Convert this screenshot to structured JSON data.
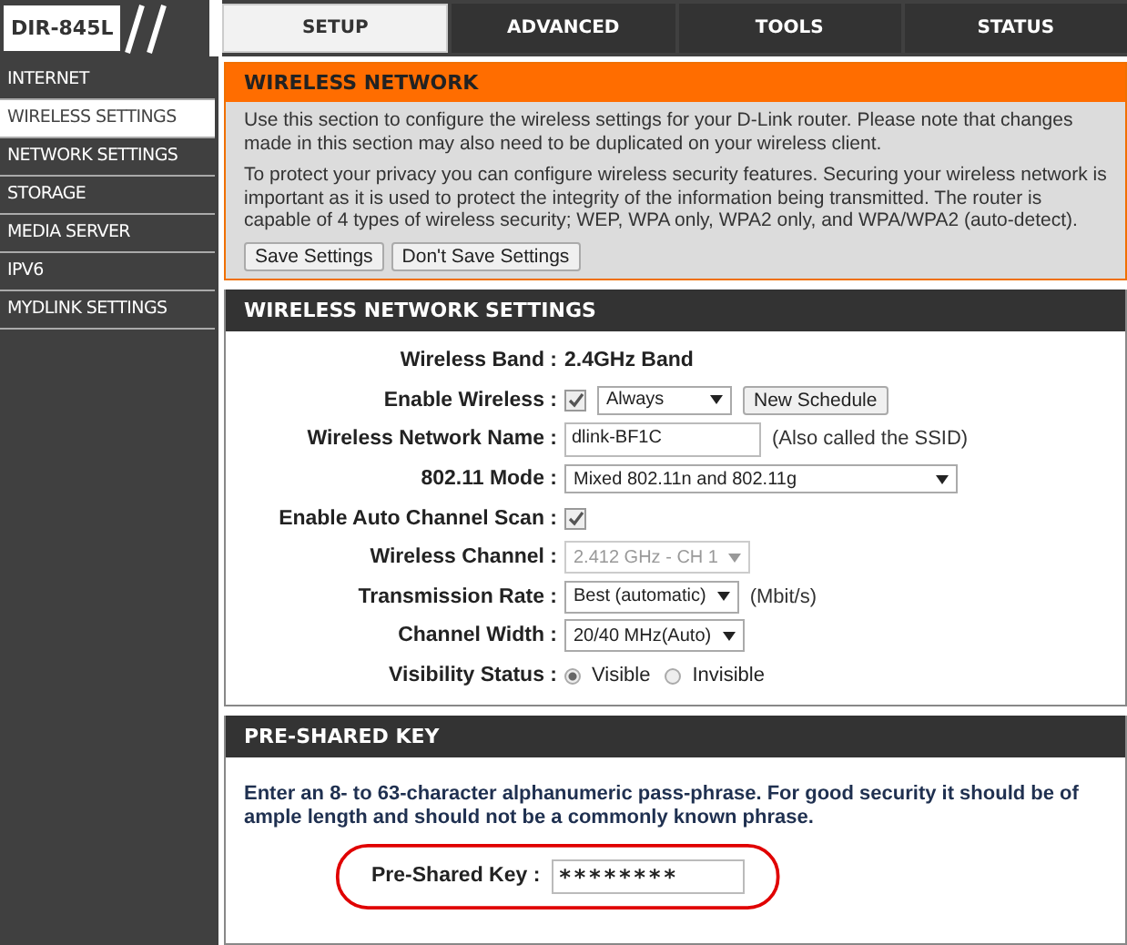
{
  "logo": "DIR-845L",
  "tabs": [
    {
      "label": "SETUP",
      "selected": true
    },
    {
      "label": "ADVANCED",
      "selected": false
    },
    {
      "label": "TOOLS",
      "selected": false
    },
    {
      "label": "STATUS",
      "selected": false
    }
  ],
  "sidebar": {
    "items": [
      {
        "label": "INTERNET",
        "selected": false
      },
      {
        "label": "WIRELESS SETTINGS",
        "selected": true
      },
      {
        "label": "NETWORK SETTINGS",
        "selected": false
      },
      {
        "label": "STORAGE",
        "selected": false
      },
      {
        "label": "MEDIA SERVER",
        "selected": false
      },
      {
        "label": "IPV6",
        "selected": false
      },
      {
        "label": "MYDLINK SETTINGS",
        "selected": false
      }
    ]
  },
  "intro": {
    "title": "WIRELESS NETWORK",
    "paragraphs": [
      "Use this section to configure the wireless settings for your D-Link router. Please note that changes made in this section may also need to be duplicated on your wireless client.",
      "To protect your privacy you can configure wireless security features. Securing your wireless network is important as it is used to protect the integrity of the information being transmitted. The router is capable of 4 types of wireless security; WEP, WPA only, WPA2 only, and WPA/WPA2 (auto-detect)."
    ],
    "buttons": [
      "Save Settings",
      "Don't Save Settings"
    ]
  },
  "settings": {
    "title": "WIRELESS NETWORK SETTINGS",
    "rows": [
      {
        "label": "Wireless Band :",
        "kind": "text",
        "value": "2.4GHz Band"
      },
      {
        "label": "Enable Wireless :",
        "kind": "checkbox-schedule",
        "checked": true,
        "select": "Always",
        "button": "New Schedule"
      },
      {
        "label": "Wireless Network Name :",
        "kind": "input",
        "value": "dlink-BF1C",
        "note": "(Also called the SSID)"
      },
      {
        "label": "802.11 Mode :",
        "kind": "wide-select",
        "value": "Mixed 802.11n and 802.11g",
        "disabled": false
      },
      {
        "label": "Enable Auto Channel Scan :",
        "kind": "checkbox",
        "checked": true
      },
      {
        "label": "Wireless Channel :",
        "kind": "select",
        "value": "2.412 GHz - CH 1",
        "disabled": true
      },
      {
        "label": "Transmission Rate :",
        "kind": "select",
        "value": "Best (automatic)",
        "disabled": false,
        "note": "(Mbit/s)"
      },
      {
        "label": "Channel Width :",
        "kind": "select",
        "value": "20/40 MHz(Auto)",
        "disabled": false
      },
      {
        "label": "Visibility Status :",
        "kind": "radios",
        "options": [
          {
            "label": "Visible",
            "selected": true
          },
          {
            "label": "Invisible",
            "selected": false
          }
        ]
      }
    ]
  },
  "psk": {
    "title": "PRE-SHARED KEY",
    "text": "Enter an 8- to 63-character alphanumeric pass-phrase. For good security it should be of ample length and should not be a commonly known phrase.",
    "label": "Pre-Shared Key :",
    "value": "********",
    "highlighted": true
  }
}
